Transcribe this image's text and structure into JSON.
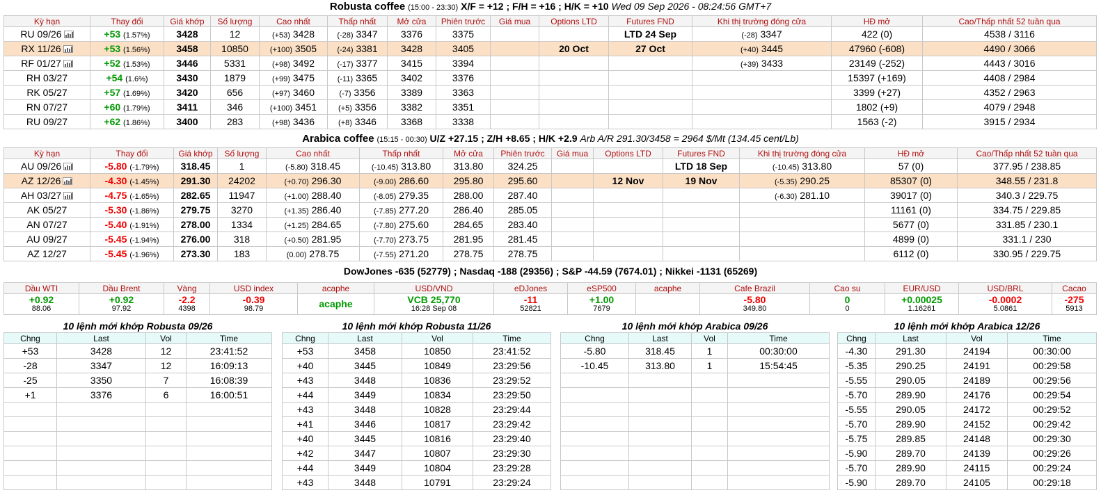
{
  "robusta": {
    "title_name": "Robusta coffee",
    "title_hours": "(15:00 - 23:30)",
    "title_spreads": "X/F = +12 ; F/H = +16 ; H/K = +10",
    "title_time": "Wed 09 Sep 2026 - 08:24:56 GMT+7",
    "headers": [
      "Kỳ hạn",
      "Thay đổi",
      "Giá khớp",
      "Số lượng",
      "Cao nhất",
      "Thấp nhất",
      "Mở cửa",
      "Phiên trước",
      "Giá mua",
      "Options LTD",
      "Futures FND",
      "Khi thị trường đóng cửa",
      "HĐ mở",
      "Cao/Thấp nhất 52 tuần qua"
    ],
    "rows": [
      {
        "term": "RU 09/26",
        "chart": true,
        "chg": "+53",
        "pct": "(1.57%)",
        "dir": "up",
        "last": "3428",
        "vol": "12",
        "high_d": "(+53)",
        "high": "3428",
        "low_d": "(-28)",
        "low": "3347",
        "open": "3376",
        "prev": "3375",
        "bid": "",
        "opt": "",
        "fnd": "LTD 24 Sep",
        "close_d": "(-28)",
        "close": "3347",
        "oi": "422 (0)",
        "range": "4538 / 3116",
        "hl": false
      },
      {
        "term": "RX 11/26",
        "chart": true,
        "chg": "+53",
        "pct": "(1.56%)",
        "dir": "up",
        "last": "3458",
        "vol": "10850",
        "high_d": "(+100)",
        "high": "3505",
        "low_d": "(-24)",
        "low": "3381",
        "open": "3428",
        "prev": "3405",
        "bid": "",
        "opt": "20 Oct",
        "fnd": "27 Oct",
        "close_d": "(+40)",
        "close": "3445",
        "oi": "47960 (-608)",
        "range": "4490 / 3066",
        "hl": true
      },
      {
        "term": "RF 01/27",
        "chart": true,
        "chg": "+52",
        "pct": "(1.53%)",
        "dir": "up",
        "last": "3446",
        "vol": "5331",
        "high_d": "(+98)",
        "high": "3492",
        "low_d": "(-17)",
        "low": "3377",
        "open": "3415",
        "prev": "3394",
        "bid": "",
        "opt": "",
        "fnd": "",
        "close_d": "(+39)",
        "close": "3433",
        "oi": "23149 (-252)",
        "range": "4443 / 3016",
        "hl": false
      },
      {
        "term": "RH 03/27",
        "chart": false,
        "chg": "+54",
        "pct": "(1.6%)",
        "dir": "up",
        "last": "3430",
        "vol": "1879",
        "high_d": "(+99)",
        "high": "3475",
        "low_d": "(-11)",
        "low": "3365",
        "open": "3402",
        "prev": "3376",
        "bid": "",
        "opt": "",
        "fnd": "",
        "close_d": "",
        "close": "",
        "oi": "15397 (+169)",
        "range": "4408 / 2984",
        "hl": false
      },
      {
        "term": "RK 05/27",
        "chart": false,
        "chg": "+57",
        "pct": "(1.69%)",
        "dir": "up",
        "last": "3420",
        "vol": "656",
        "high_d": "(+97)",
        "high": "3460",
        "low_d": "(-7)",
        "low": "3356",
        "open": "3389",
        "prev": "3363",
        "bid": "",
        "opt": "",
        "fnd": "",
        "close_d": "",
        "close": "",
        "oi": "3399 (+27)",
        "range": "4352 / 2963",
        "hl": false
      },
      {
        "term": "RN 07/27",
        "chart": false,
        "chg": "+60",
        "pct": "(1.79%)",
        "dir": "up",
        "last": "3411",
        "vol": "346",
        "high_d": "(+100)",
        "high": "3451",
        "low_d": "(+5)",
        "low": "3356",
        "open": "3382",
        "prev": "3351",
        "bid": "",
        "opt": "",
        "fnd": "",
        "close_d": "",
        "close": "",
        "oi": "1802 (+9)",
        "range": "4079 / 2948",
        "hl": false
      },
      {
        "term": "RU 09/27",
        "chart": false,
        "chg": "+62",
        "pct": "(1.86%)",
        "dir": "up",
        "last": "3400",
        "vol": "283",
        "high_d": "(+98)",
        "high": "3436",
        "low_d": "(+8)",
        "low": "3346",
        "open": "3368",
        "prev": "3338",
        "bid": "",
        "opt": "",
        "fnd": "",
        "close_d": "",
        "close": "",
        "oi": "1563 (-2)",
        "range": "3915 / 2934",
        "hl": false
      }
    ]
  },
  "arabica": {
    "title_name": "Arabica coffee",
    "title_hours": "(15:15 - 00:30)",
    "title_spreads": "U/Z +27.15 ; Z/H +8.65 ; H/K +2.9",
    "title_arb": "Arb A/R 291.30/3458 = 2964 $/Mt (134.45 cent/Lb)",
    "headers": [
      "Kỳ hạn",
      "Thay đổi",
      "Giá khớp",
      "Số lượng",
      "Cao nhất",
      "Thấp nhất",
      "Mở cửa",
      "Phiên trước",
      "Giá mua",
      "Options LTD",
      "Futures FND",
      "Khi thị trường đóng cửa",
      "HĐ mở",
      "Cao/Thấp nhất 52 tuần qua"
    ],
    "rows": [
      {
        "term": "AU 09/26",
        "chart": true,
        "chg": "-5.80",
        "pct": "(-1.79%)",
        "dir": "dn",
        "last": "318.45",
        "vol": "1",
        "high_d": "(-5.80)",
        "high": "318.45",
        "low_d": "(-10.45)",
        "low": "313.80",
        "open": "313.80",
        "prev": "324.25",
        "bid": "",
        "opt": "",
        "fnd": "LTD 18 Sep",
        "close_d": "(-10.45)",
        "close": "313.80",
        "oi": "57 (0)",
        "range": "377.95 / 238.85",
        "hl": false
      },
      {
        "term": "AZ 12/26",
        "chart": true,
        "chg": "-4.30",
        "pct": "(-1.45%)",
        "dir": "dn",
        "last": "291.30",
        "vol": "24202",
        "high_d": "(+0.70)",
        "high": "296.30",
        "low_d": "(-9.00)",
        "low": "286.60",
        "open": "295.80",
        "prev": "295.60",
        "bid": "",
        "opt": "12 Nov",
        "fnd": "19 Nov",
        "close_d": "(-5.35)",
        "close": "290.25",
        "oi": "85307 (0)",
        "range": "348.55 / 231.8",
        "hl": true
      },
      {
        "term": "AH 03/27",
        "chart": true,
        "chg": "-4.75",
        "pct": "(-1.65%)",
        "dir": "dn",
        "last": "282.65",
        "vol": "11947",
        "high_d": "(+1.00)",
        "high": "288.40",
        "low_d": "(-8.05)",
        "low": "279.35",
        "open": "288.00",
        "prev": "287.40",
        "bid": "",
        "opt": "",
        "fnd": "",
        "close_d": "(-6.30)",
        "close": "281.10",
        "oi": "39017 (0)",
        "range": "340.3 / 229.75",
        "hl": false
      },
      {
        "term": "AK 05/27",
        "chart": false,
        "chg": "-5.30",
        "pct": "(-1.86%)",
        "dir": "dn",
        "last": "279.75",
        "vol": "3270",
        "high_d": "(+1.35)",
        "high": "286.40",
        "low_d": "(-7.85)",
        "low": "277.20",
        "open": "286.40",
        "prev": "285.05",
        "bid": "",
        "opt": "",
        "fnd": "",
        "close_d": "",
        "close": "",
        "oi": "11161 (0)",
        "range": "334.75 / 229.85",
        "hl": false
      },
      {
        "term": "AN 07/27",
        "chart": false,
        "chg": "-5.40",
        "pct": "(-1.91%)",
        "dir": "dn",
        "last": "278.00",
        "vol": "1334",
        "high_d": "(+1.25)",
        "high": "284.65",
        "low_d": "(-7.80)",
        "low": "275.60",
        "open": "284.65",
        "prev": "283.40",
        "bid": "",
        "opt": "",
        "fnd": "",
        "close_d": "",
        "close": "",
        "oi": "5677 (0)",
        "range": "331.85 / 230.1",
        "hl": false
      },
      {
        "term": "AU 09/27",
        "chart": false,
        "chg": "-5.45",
        "pct": "(-1.94%)",
        "dir": "dn",
        "last": "276.00",
        "vol": "318",
        "high_d": "(+0.50)",
        "high": "281.95",
        "low_d": "(-7.70)",
        "low": "273.75",
        "open": "281.95",
        "prev": "281.45",
        "bid": "",
        "opt": "",
        "fnd": "",
        "close_d": "",
        "close": "",
        "oi": "4899 (0)",
        "range": "331.1 / 230",
        "hl": false
      },
      {
        "term": "AZ 12/27",
        "chart": false,
        "chg": "-5.45",
        "pct": "(-1.96%)",
        "dir": "dn",
        "last": "273.30",
        "vol": "183",
        "high_d": "(0.00)",
        "high": "278.75",
        "low_d": "(-7.55)",
        "low": "271.20",
        "open": "278.75",
        "prev": "278.75",
        "bid": "",
        "opt": "",
        "fnd": "",
        "close_d": "",
        "close": "",
        "oi": "6112 (0)",
        "range": "330.95 / 229.75",
        "hl": false
      }
    ]
  },
  "indices": "DowJones -635 (52779) ; Nasdaq -188 (29356) ; S&P -44.59 (7674.01) ; Nikkei -1131 (65269)",
  "markets": [
    {
      "name": "Dầu WTI",
      "chg": "+0.92",
      "val": "88.06",
      "color": "#009900"
    },
    {
      "name": "Dầu Brent",
      "chg": "+0.92",
      "val": "97.92",
      "color": "#009900"
    },
    {
      "name": "Vàng",
      "chg": "-2.2",
      "val": "4398",
      "color": "#ee0000"
    },
    {
      "name": "USD index",
      "chg": "-0.39",
      "val": "98.79",
      "color": "#ee0000"
    },
    {
      "name": "acaphe",
      "chg": "acaphe",
      "val": "",
      "color": "#009900"
    },
    {
      "name": "USD/VND",
      "chg": "VCB 25,770",
      "val": "16:28 Sep 08",
      "color": "#009900"
    },
    {
      "name": "eDJones",
      "chg": "-11",
      "val": "52821",
      "color": "#ee0000"
    },
    {
      "name": "eSP500",
      "chg": "+1.00",
      "val": "7679",
      "color": "#009900"
    },
    {
      "name": "acaphe",
      "chg": "",
      "val": "",
      "color": "#009900"
    },
    {
      "name": "Cafe Brazil",
      "chg": "-5.80",
      "val": "349.80",
      "color": "#ee0000"
    },
    {
      "name": "Cao su",
      "chg": "0",
      "val": "0",
      "color": "#009900"
    },
    {
      "name": "EUR/USD",
      "chg": "+0.00025",
      "val": "1.16261",
      "color": "#009900"
    },
    {
      "name": "USD/BRL",
      "chg": "-0.0002",
      "val": "5.0861",
      "color": "#ee0000"
    },
    {
      "name": "Cacao",
      "chg": "-275",
      "val": "5913",
      "color": "#ee0000"
    }
  ],
  "trades": [
    {
      "title": "10 lệnh mới khớp Robusta 09/26",
      "cols": [
        "Chng",
        "Last",
        "Vol",
        "Time"
      ],
      "rows": [
        [
          "+53",
          "3428",
          "12",
          "23:41:52"
        ],
        [
          "-28",
          "3347",
          "12",
          "16:09:13"
        ],
        [
          "-25",
          "3350",
          "7",
          "16:08:39"
        ],
        [
          "+1",
          "3376",
          "6",
          "16:00:51"
        ],
        [
          "",
          "",
          "",
          ""
        ],
        [
          "",
          "",
          "",
          ""
        ],
        [
          "",
          "",
          "",
          ""
        ],
        [
          "",
          "",
          "",
          ""
        ],
        [
          "",
          "",
          "",
          ""
        ],
        [
          "",
          "",
          "",
          ""
        ]
      ]
    },
    {
      "title": "10 lệnh mới khớp Robusta 11/26",
      "cols": [
        "Chng",
        "Last",
        "Vol",
        "Time"
      ],
      "rows": [
        [
          "+53",
          "3458",
          "10850",
          "23:41:52"
        ],
        [
          "+40",
          "3445",
          "10849",
          "23:29:56"
        ],
        [
          "+43",
          "3448",
          "10836",
          "23:29:52"
        ],
        [
          "+44",
          "3449",
          "10834",
          "23:29:50"
        ],
        [
          "+43",
          "3448",
          "10828",
          "23:29:44"
        ],
        [
          "+41",
          "3446",
          "10817",
          "23:29:42"
        ],
        [
          "+40",
          "3445",
          "10816",
          "23:29:40"
        ],
        [
          "+42",
          "3447",
          "10807",
          "23:29:30"
        ],
        [
          "+44",
          "3449",
          "10804",
          "23:29:28"
        ],
        [
          "+43",
          "3448",
          "10791",
          "23:29:24"
        ]
      ]
    },
    {
      "title": "10 lệnh mới khớp Arabica 09/26",
      "cols": [
        "Chng",
        "Last",
        "Vol",
        "Time"
      ],
      "rows": [
        [
          "-5.80",
          "318.45",
          "1",
          "00:30:00"
        ],
        [
          "-10.45",
          "313.80",
          "1",
          "15:54:45"
        ],
        [
          "",
          "",
          "",
          ""
        ],
        [
          "",
          "",
          "",
          ""
        ],
        [
          "",
          "",
          "",
          ""
        ],
        [
          "",
          "",
          "",
          ""
        ],
        [
          "",
          "",
          "",
          ""
        ],
        [
          "",
          "",
          "",
          ""
        ],
        [
          "",
          "",
          "",
          ""
        ],
        [
          "",
          "",
          "",
          ""
        ]
      ]
    },
    {
      "title": "10 lệnh mới khớp Arabica 12/26",
      "cols": [
        "Chng",
        "Last",
        "Vol",
        "Time"
      ],
      "rows": [
        [
          "-4.30",
          "291.30",
          "24194",
          "00:30:00"
        ],
        [
          "-5.35",
          "290.25",
          "24191",
          "00:29:58"
        ],
        [
          "-5.55",
          "290.05",
          "24189",
          "00:29:56"
        ],
        [
          "-5.70",
          "289.90",
          "24176",
          "00:29:54"
        ],
        [
          "-5.55",
          "290.05",
          "24172",
          "00:29:52"
        ],
        [
          "-5.70",
          "289.90",
          "24152",
          "00:29:42"
        ],
        [
          "-5.75",
          "289.85",
          "24148",
          "00:29:30"
        ],
        [
          "-5.90",
          "289.70",
          "24139",
          "00:29:26"
        ],
        [
          "-5.70",
          "289.90",
          "24115",
          "00:29:24"
        ],
        [
          "-5.90",
          "289.70",
          "24105",
          "00:29:18"
        ]
      ]
    }
  ]
}
